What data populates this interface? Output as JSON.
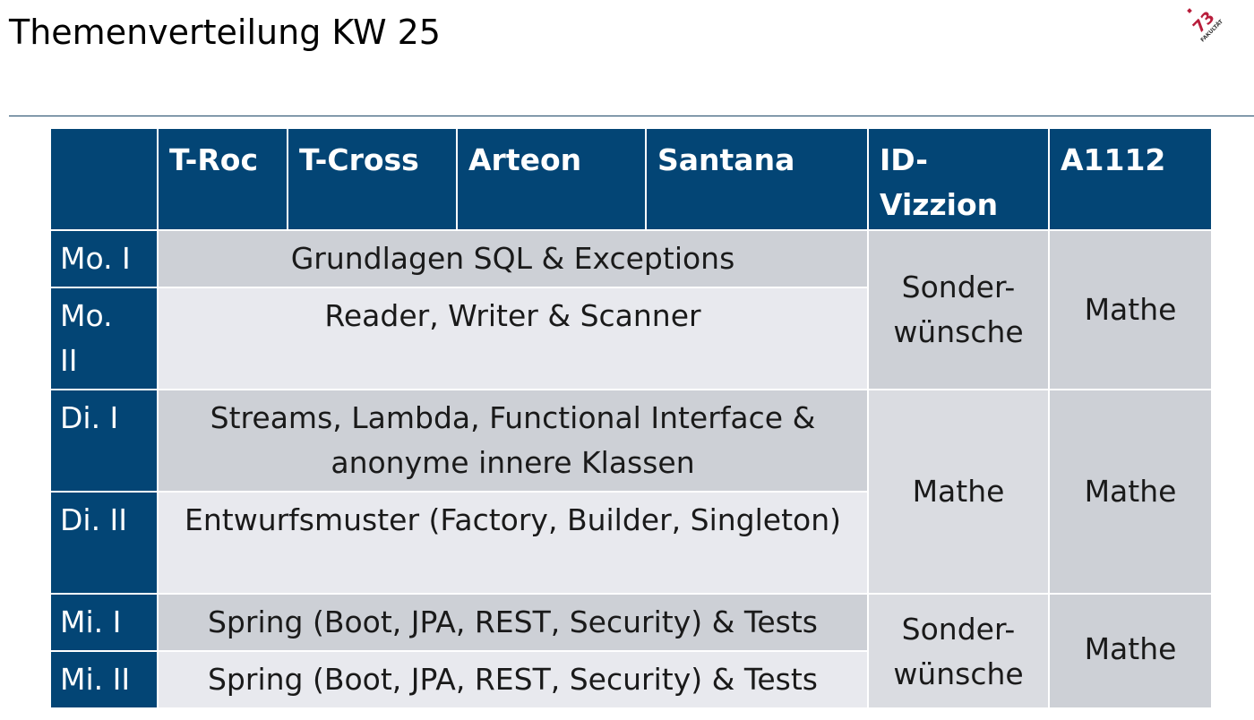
{
  "page": {
    "title": "Themenverteilung KW 25",
    "logo_text": "FAKULTÄT 73"
  },
  "colors": {
    "header_bg": "#034575",
    "header_text": "#ffffff",
    "row_dark": "#cdd0d6",
    "row_light": "#e8e9ee",
    "rule": "#1c4766"
  },
  "table": {
    "columns": [
      "",
      "T-Roc",
      "T-Cross",
      "Arteon",
      "Santana",
      "ID-\nVizzion",
      "A1112"
    ],
    "rows": [
      {
        "label": "Mo. I",
        "topic": "Grundlagen SQL & Exceptions"
      },
      {
        "label": "Mo.\nII",
        "topic": "Reader, Writer & Scanner"
      },
      {
        "label": "Di. I",
        "topic": "Streams, Lambda, Functional Interface & anonyme innere Klassen"
      },
      {
        "label": "Di. II",
        "topic": "Entwurfsmuster (Factory, Builder, Singleton)"
      },
      {
        "label": "Mi. I",
        "topic": "Spring (Boot, JPA, REST, Security) & Tests"
      },
      {
        "label": "Mi. II",
        "topic": "Spring (Boot, JPA, REST, Security) & Tests"
      }
    ],
    "id_vizzion": [
      {
        "rows": "Mo. I–Mo. II",
        "text": "Sonder-\nwünsche"
      },
      {
        "rows": "Di. I–Di. II",
        "text": "Mathe"
      },
      {
        "rows": "Mi. I–Mi. II",
        "text": "Sonder-\nwünsche"
      }
    ],
    "a1112": [
      {
        "rows": "Mo. I–Mo. II",
        "text": "Mathe"
      },
      {
        "rows": "Di. I–Di. II",
        "text": "Mathe"
      },
      {
        "rows": "Mi. I–Mi. II",
        "text": "Mathe"
      }
    ]
  }
}
